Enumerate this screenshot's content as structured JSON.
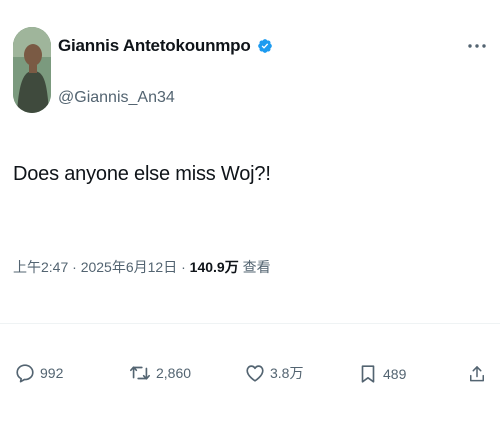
{
  "author": {
    "display_name": "Giannis Antetokounmpo",
    "handle": "@Giannis_An34",
    "verified": true
  },
  "tweet": {
    "text": "Does anyone else miss Woj?!"
  },
  "meta": {
    "time": "上午2:47",
    "separator": " · ",
    "date": "2025年6月12日",
    "views_count": "140.9万",
    "views_label": " 查看"
  },
  "actions": {
    "replies": "992",
    "retweets": "2,860",
    "likes": "3.8万",
    "bookmarks": "489"
  },
  "colors": {
    "verified_blue": "#1d9bf0",
    "secondary_text": "#536471",
    "primary_text": "#0f1419"
  }
}
